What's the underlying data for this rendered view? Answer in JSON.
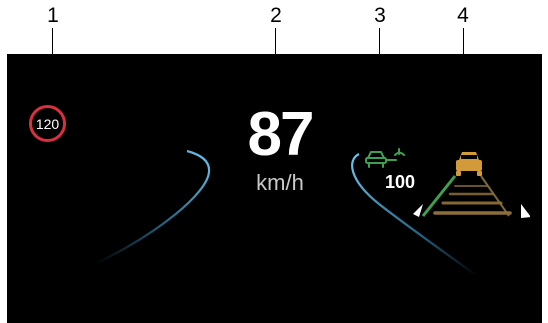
{
  "callouts": [
    {
      "number": "1",
      "refers_to": "speed-limit-sign"
    },
    {
      "number": "2",
      "refers_to": "current-speed"
    },
    {
      "number": "3",
      "refers_to": "adaptive-cruise-control"
    },
    {
      "number": "4",
      "refers_to": "lane-assist"
    }
  ],
  "hud": {
    "speed_limit": "120",
    "current_speed": "87",
    "speed_unit": "km/h",
    "acc_set_speed": "100",
    "colors": {
      "background": "#000000",
      "speed_limit_ring": "#d8303f",
      "acc_icon": "#3fa04f",
      "lane_edge": "#3fa6d8",
      "lane_green": "#3fa04f",
      "vehicle_ahead": "#d39a3a"
    },
    "icons": {
      "acc": "adaptive-cruise-car-icon",
      "lane": "lane-assist-road-icon",
      "vehicle": "vehicle-ahead-icon"
    }
  }
}
